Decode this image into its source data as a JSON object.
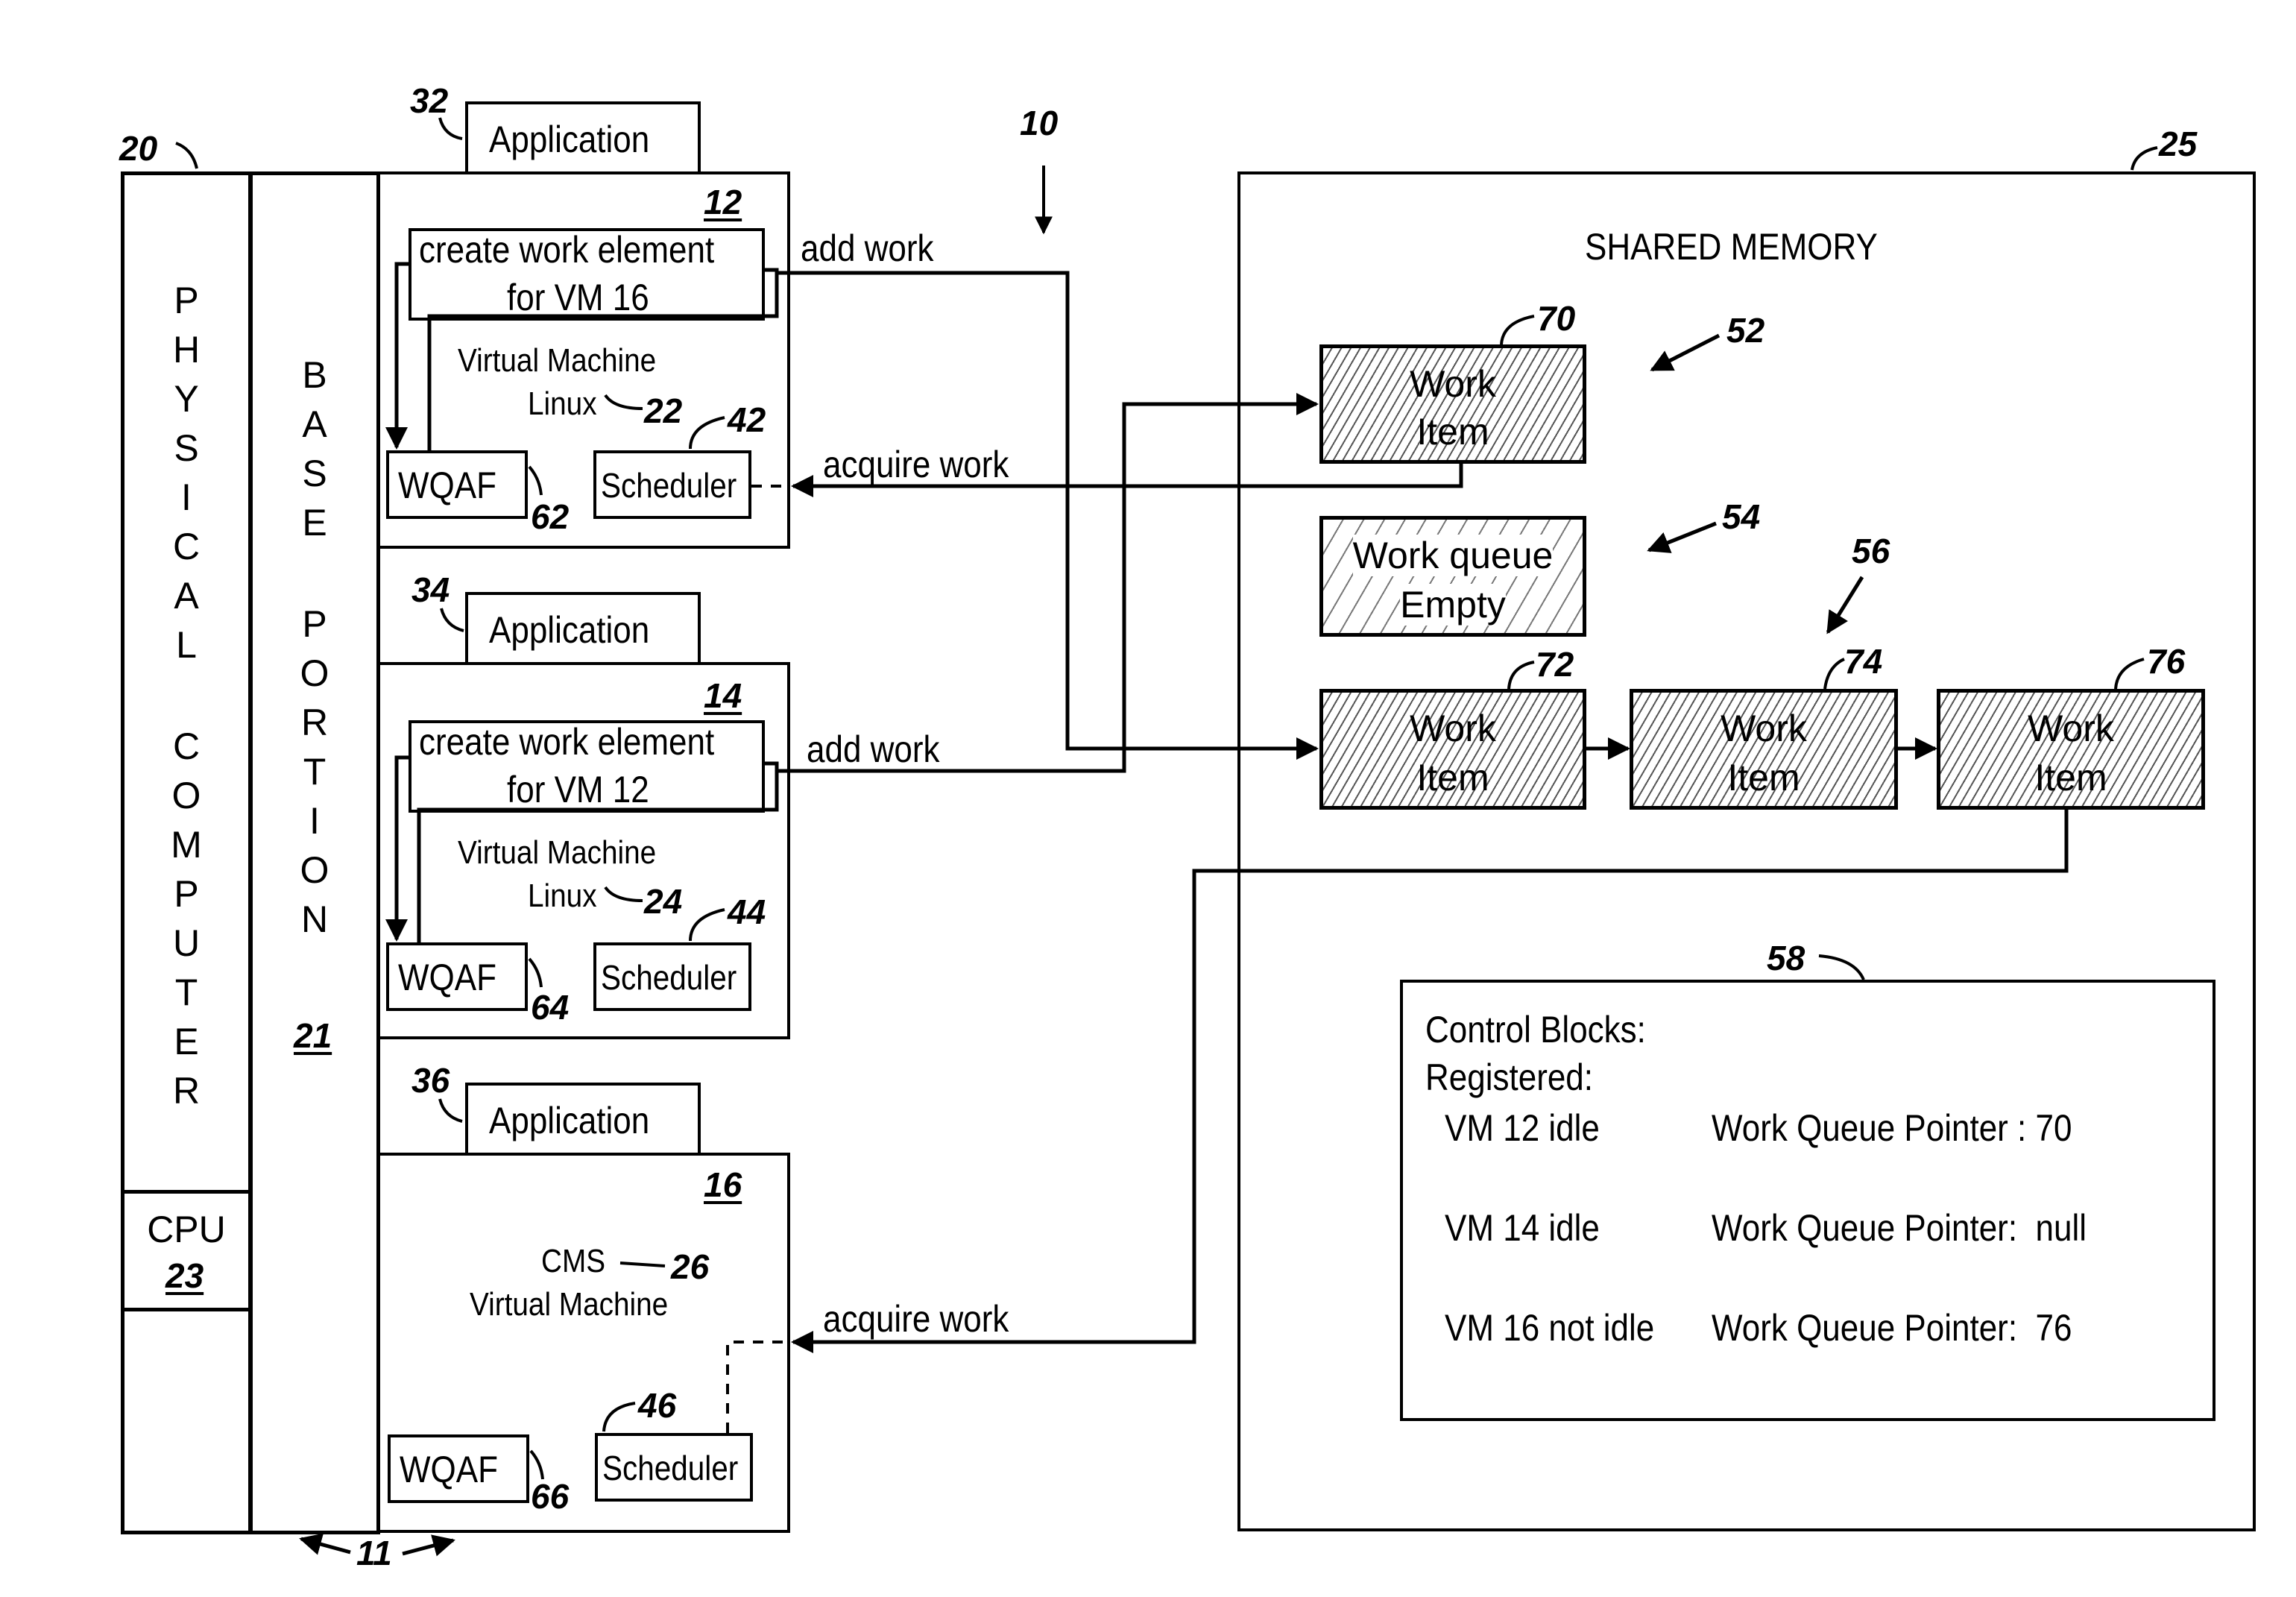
{
  "figure_ref": "10",
  "physical_computer": {
    "label": "PHYSICAL COMPUTER",
    "letters_line1": [
      "P",
      "H",
      "Y",
      "S",
      "I",
      "C",
      "A",
      "L"
    ],
    "letters_line2": [
      "C",
      "O",
      "M",
      "P",
      "U",
      "T",
      "E",
      "R"
    ],
    "ref": "20",
    "cpu": {
      "label": "CPU",
      "ref": "23"
    }
  },
  "base_portion": {
    "letters_line1": [
      "B",
      "A",
      "S",
      "E"
    ],
    "letters_line2": [
      "P",
      "O",
      "R",
      "T",
      "I",
      "O",
      "N"
    ],
    "ref": "21",
    "bracket_ref": "11"
  },
  "vms": [
    {
      "ref": "12",
      "app": {
        "label": "Application",
        "ref": "32"
      },
      "create": {
        "line1": "create work element",
        "line2": "for VM 16"
      },
      "vm_label": "Virtual Machine",
      "os_label": "Linux",
      "os_ref": "22",
      "wqaf": {
        "label": "WQAF",
        "ref": "62"
      },
      "scheduler": {
        "label": "Scheduler",
        "ref": "42"
      },
      "add_work_label": "add work",
      "acquire_work_label": "acquire work"
    },
    {
      "ref": "14",
      "app": {
        "label": "Application",
        "ref": "34"
      },
      "create": {
        "line1": "create work element",
        "line2": "for VM 12"
      },
      "vm_label": "Virtual Machine",
      "os_label": "Linux",
      "os_ref": "24",
      "wqaf": {
        "label": "WQAF",
        "ref": "64"
      },
      "scheduler": {
        "label": "Scheduler",
        "ref": "44"
      },
      "add_work_label": "add work"
    },
    {
      "ref": "16",
      "app": {
        "label": "Application",
        "ref": "36"
      },
      "os_label": "CMS",
      "os_ref": "26",
      "vm_label": "Virtual Machine",
      "wqaf": {
        "label": "WQAF",
        "ref": "66"
      },
      "scheduler": {
        "label": "Scheduler",
        "ref": "46"
      },
      "acquire_work_label": "acquire work"
    }
  ],
  "shared_memory": {
    "title": "SHARED MEMORY",
    "ref": "25",
    "queue_52": {
      "ref": "52",
      "items": [
        {
          "ref": "70",
          "line1": "Work",
          "line2": "Item"
        }
      ]
    },
    "queue_54": {
      "ref": "54",
      "line1": "Work queue",
      "line2": "Empty"
    },
    "queue_56": {
      "ref": "56",
      "items": [
        {
          "ref": "72",
          "line1": "Work",
          "line2": "Item"
        },
        {
          "ref": "74",
          "line1": "Work",
          "line2": "Item"
        },
        {
          "ref": "76",
          "line1": "Work",
          "line2": "Item"
        }
      ]
    },
    "control_blocks": {
      "ref": "58",
      "title": "Control Blocks:",
      "subtitle": "Registered:",
      "rows": [
        {
          "vm": "VM 12 idle",
          "pointer": "Work Queue Pointer : 70"
        },
        {
          "vm": "VM 14 idle",
          "pointer": "Work Queue Pointer:  null"
        },
        {
          "vm": "VM 16 not idle",
          "pointer": "Work Queue Pointer:  76"
        }
      ]
    }
  }
}
